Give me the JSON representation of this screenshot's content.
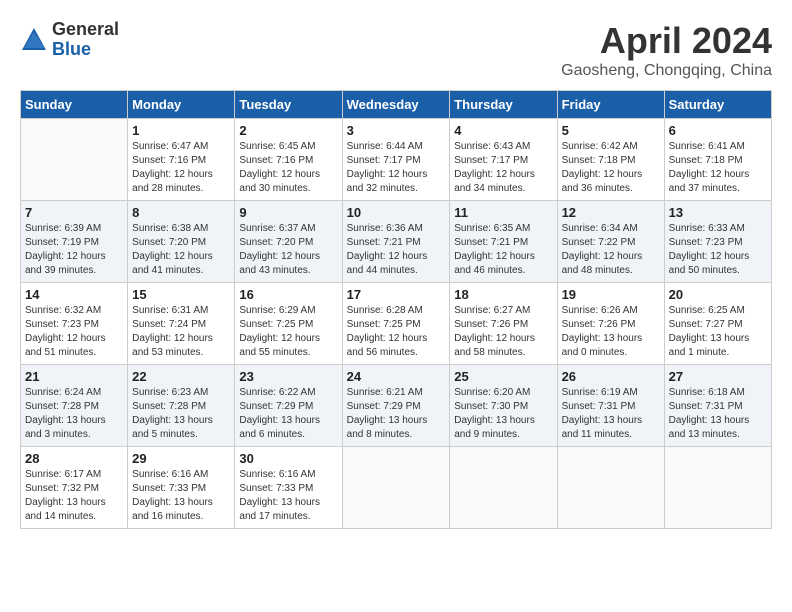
{
  "logo": {
    "general": "General",
    "blue": "Blue"
  },
  "title": "April 2024",
  "subtitle": "Gaosheng, Chongqing, China",
  "weekdays": [
    "Sunday",
    "Monday",
    "Tuesday",
    "Wednesday",
    "Thursday",
    "Friday",
    "Saturday"
  ],
  "weeks": [
    [
      {
        "day": "",
        "info": ""
      },
      {
        "day": "1",
        "info": "Sunrise: 6:47 AM\nSunset: 7:16 PM\nDaylight: 12 hours\nand 28 minutes."
      },
      {
        "day": "2",
        "info": "Sunrise: 6:45 AM\nSunset: 7:16 PM\nDaylight: 12 hours\nand 30 minutes."
      },
      {
        "day": "3",
        "info": "Sunrise: 6:44 AM\nSunset: 7:17 PM\nDaylight: 12 hours\nand 32 minutes."
      },
      {
        "day": "4",
        "info": "Sunrise: 6:43 AM\nSunset: 7:17 PM\nDaylight: 12 hours\nand 34 minutes."
      },
      {
        "day": "5",
        "info": "Sunrise: 6:42 AM\nSunset: 7:18 PM\nDaylight: 12 hours\nand 36 minutes."
      },
      {
        "day": "6",
        "info": "Sunrise: 6:41 AM\nSunset: 7:18 PM\nDaylight: 12 hours\nand 37 minutes."
      }
    ],
    [
      {
        "day": "7",
        "info": "Sunrise: 6:39 AM\nSunset: 7:19 PM\nDaylight: 12 hours\nand 39 minutes."
      },
      {
        "day": "8",
        "info": "Sunrise: 6:38 AM\nSunset: 7:20 PM\nDaylight: 12 hours\nand 41 minutes."
      },
      {
        "day": "9",
        "info": "Sunrise: 6:37 AM\nSunset: 7:20 PM\nDaylight: 12 hours\nand 43 minutes."
      },
      {
        "day": "10",
        "info": "Sunrise: 6:36 AM\nSunset: 7:21 PM\nDaylight: 12 hours\nand 44 minutes."
      },
      {
        "day": "11",
        "info": "Sunrise: 6:35 AM\nSunset: 7:21 PM\nDaylight: 12 hours\nand 46 minutes."
      },
      {
        "day": "12",
        "info": "Sunrise: 6:34 AM\nSunset: 7:22 PM\nDaylight: 12 hours\nand 48 minutes."
      },
      {
        "day": "13",
        "info": "Sunrise: 6:33 AM\nSunset: 7:23 PM\nDaylight: 12 hours\nand 50 minutes."
      }
    ],
    [
      {
        "day": "14",
        "info": "Sunrise: 6:32 AM\nSunset: 7:23 PM\nDaylight: 12 hours\nand 51 minutes."
      },
      {
        "day": "15",
        "info": "Sunrise: 6:31 AM\nSunset: 7:24 PM\nDaylight: 12 hours\nand 53 minutes."
      },
      {
        "day": "16",
        "info": "Sunrise: 6:29 AM\nSunset: 7:25 PM\nDaylight: 12 hours\nand 55 minutes."
      },
      {
        "day": "17",
        "info": "Sunrise: 6:28 AM\nSunset: 7:25 PM\nDaylight: 12 hours\nand 56 minutes."
      },
      {
        "day": "18",
        "info": "Sunrise: 6:27 AM\nSunset: 7:26 PM\nDaylight: 12 hours\nand 58 minutes."
      },
      {
        "day": "19",
        "info": "Sunrise: 6:26 AM\nSunset: 7:26 PM\nDaylight: 13 hours\nand 0 minutes."
      },
      {
        "day": "20",
        "info": "Sunrise: 6:25 AM\nSunset: 7:27 PM\nDaylight: 13 hours\nand 1 minute."
      }
    ],
    [
      {
        "day": "21",
        "info": "Sunrise: 6:24 AM\nSunset: 7:28 PM\nDaylight: 13 hours\nand 3 minutes."
      },
      {
        "day": "22",
        "info": "Sunrise: 6:23 AM\nSunset: 7:28 PM\nDaylight: 13 hours\nand 5 minutes."
      },
      {
        "day": "23",
        "info": "Sunrise: 6:22 AM\nSunset: 7:29 PM\nDaylight: 13 hours\nand 6 minutes."
      },
      {
        "day": "24",
        "info": "Sunrise: 6:21 AM\nSunset: 7:29 PM\nDaylight: 13 hours\nand 8 minutes."
      },
      {
        "day": "25",
        "info": "Sunrise: 6:20 AM\nSunset: 7:30 PM\nDaylight: 13 hours\nand 9 minutes."
      },
      {
        "day": "26",
        "info": "Sunrise: 6:19 AM\nSunset: 7:31 PM\nDaylight: 13 hours\nand 11 minutes."
      },
      {
        "day": "27",
        "info": "Sunrise: 6:18 AM\nSunset: 7:31 PM\nDaylight: 13 hours\nand 13 minutes."
      }
    ],
    [
      {
        "day": "28",
        "info": "Sunrise: 6:17 AM\nSunset: 7:32 PM\nDaylight: 13 hours\nand 14 minutes."
      },
      {
        "day": "29",
        "info": "Sunrise: 6:16 AM\nSunset: 7:33 PM\nDaylight: 13 hours\nand 16 minutes."
      },
      {
        "day": "30",
        "info": "Sunrise: 6:16 AM\nSunset: 7:33 PM\nDaylight: 13 hours\nand 17 minutes."
      },
      {
        "day": "",
        "info": ""
      },
      {
        "day": "",
        "info": ""
      },
      {
        "day": "",
        "info": ""
      },
      {
        "day": "",
        "info": ""
      }
    ]
  ]
}
